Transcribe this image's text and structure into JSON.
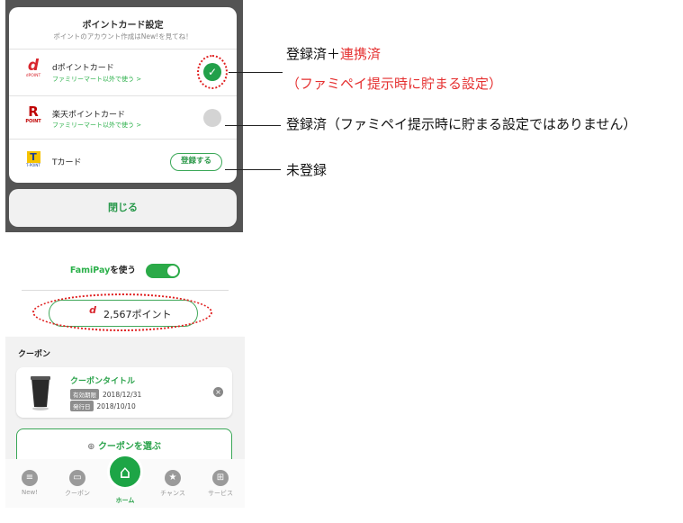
{
  "settings_sheet": {
    "title": "ポイントカード設定",
    "subtitle": "ポイントのアカウント作成はNew!を見てね！",
    "cards": [
      {
        "logo_text": "d",
        "logo_sub": "dPOINT",
        "name": "dポイントカード",
        "link": "ファミリーマート以外で使う >",
        "status": "checked"
      },
      {
        "logo_text": "R",
        "logo_sub": "POINT",
        "name": "楽天ポイントカード",
        "link": "ファミリーマート以外で使う >",
        "status": "unchecked"
      },
      {
        "logo_text": "T",
        "logo_sub": "T-POINT",
        "name": "Tカード",
        "link": "",
        "status": "unregistered",
        "button": "登録する"
      }
    ],
    "close_label": "閉じる"
  },
  "annotations": {
    "row1_line1_black": "登録済＋",
    "row1_line1_red": "連携済",
    "row1_line2": "（ファミペイ提示時に貯まる設定）",
    "row2": "登録済（ファミペイ提示時に貯まる設定ではありません）",
    "row3": "未登録"
  },
  "home": {
    "famipay_brand": "FamiPay",
    "famipay_suffix": "を使う",
    "toggle_on": true,
    "points_logo": "d",
    "points_text": "2,567ポイント",
    "coupon_heading": "クーポン",
    "coupon": {
      "title": "クーポンタイトル",
      "expiry_tag": "有効期限",
      "expiry": "2018/12/31",
      "issued_tag": "発行日",
      "issued": "2018/10/10"
    },
    "choose_coupon": "クーポンを選ぶ",
    "tabs": [
      {
        "icon": "list-icon",
        "glyph": "≡",
        "label": "New!"
      },
      {
        "icon": "coupon-icon",
        "glyph": "▭",
        "label": "クーポン"
      },
      {
        "icon": "home-icon",
        "glyph": "⌂",
        "label": "ホーム"
      },
      {
        "icon": "star-icon",
        "glyph": "★",
        "label": "チャンス"
      },
      {
        "icon": "grid-icon",
        "glyph": "⊞",
        "label": "サービス"
      }
    ]
  },
  "colors": {
    "accent_green": "#2bb04a",
    "annotation_red": "#e53030",
    "ring_red": "#e02020"
  }
}
